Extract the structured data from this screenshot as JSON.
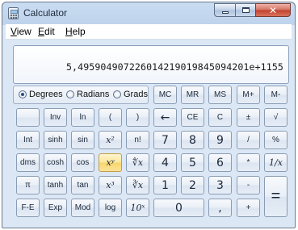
{
  "window": {
    "title": "Calculator"
  },
  "menu": [
    "View",
    "Edit",
    "Help"
  ],
  "display": {
    "value": "5,4959049072260142190198450942​01e+1155"
  },
  "angle_mode": {
    "options": [
      "Degrees",
      "Radians",
      "Grads"
    ],
    "selected": "Degrees"
  },
  "memory_keys": [
    "MC",
    "MR",
    "MS",
    "M+",
    "M-"
  ],
  "keys": {
    "blank": "",
    "inv": "Inv",
    "ln": "ln",
    "lparen": "(",
    "rparen": ")",
    "backspace": "←",
    "ce": "CE",
    "c": "C",
    "negate": "±",
    "sqrt": "√",
    "int": "Int",
    "sinh": "sinh",
    "sin": "sin",
    "x2": "x²",
    "fact": "n!",
    "n7": "7",
    "n8": "8",
    "n9": "9",
    "divide": "/",
    "percent": "%",
    "dms": "dms",
    "cosh": "cosh",
    "cos": "cos",
    "xy": "xʸ",
    "yroot": "∜x",
    "n4": "4",
    "n5": "5",
    "n6": "6",
    "multiply": "*",
    "reciprocal": "1/x",
    "pi": "π",
    "tanh": "tanh",
    "tan": "tan",
    "x3": "x³",
    "cuberoot": "∛x",
    "n1": "1",
    "n2": "2",
    "n3": "3",
    "minus": "-",
    "equals": "=",
    "fe": "F-E",
    "exp": "Exp",
    "mod": "Mod",
    "log": "log",
    "tenx": "10ˣ",
    "n0": "0",
    "decimal": ",",
    "plus": "+"
  },
  "colors": {
    "accent_highlight": "#f8d56c",
    "window_frame": "#bed3ec"
  }
}
